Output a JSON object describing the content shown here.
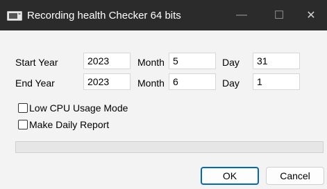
{
  "window": {
    "title": "Recording health Checker 64 bits"
  },
  "titlebar": {
    "minimize_glyph": "—",
    "maximize_glyph": "☐",
    "close_glyph": "✕"
  },
  "form": {
    "start_year_label": "Start Year",
    "start_year_value": "2023",
    "start_month_label": "Month",
    "start_month_value": "5",
    "start_day_label": "Day",
    "start_day_value": "31",
    "end_year_label": "End Year",
    "end_year_value": "2023",
    "end_month_label": "Month",
    "end_month_value": "6",
    "end_day_label": "Day",
    "end_day_value": "1"
  },
  "options": {
    "low_cpu_label": "Low CPU Usage Mode",
    "low_cpu_checked": false,
    "daily_report_label": "Make Daily Report",
    "daily_report_checked": false
  },
  "progress": {
    "value": 0
  },
  "buttons": {
    "ok_label": "OK",
    "cancel_label": "Cancel"
  },
  "icons": {
    "app": "monitor-icon",
    "minimize": "minimize-icon",
    "maximize": "maximize-icon",
    "close": "close-icon"
  },
  "colors": {
    "titlebar": "#2b2b2b",
    "accent": "#0067c0",
    "background": "#f3f3f3"
  }
}
